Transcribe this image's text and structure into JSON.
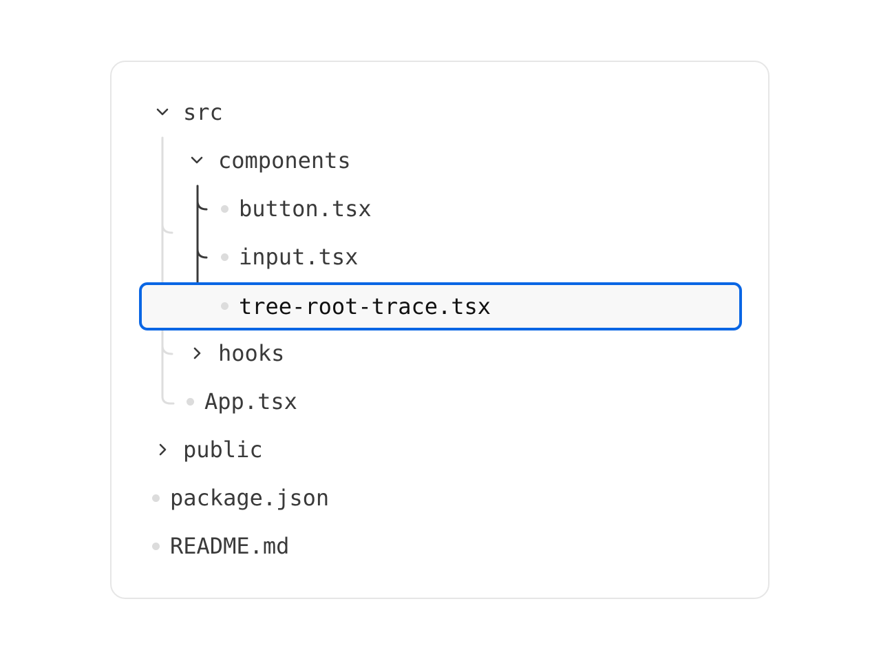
{
  "tree": {
    "src": {
      "label": "src",
      "state": "expanded"
    },
    "components": {
      "label": "components",
      "state": "expanded"
    },
    "button_tsx": {
      "label": "button.tsx"
    },
    "input_tsx": {
      "label": "input.tsx"
    },
    "tree_root_trace_tsx": {
      "label": "tree-root-trace.tsx",
      "selected": true
    },
    "hooks": {
      "label": "hooks",
      "state": "collapsed"
    },
    "app_tsx": {
      "label": "App.tsx"
    },
    "public": {
      "label": "public",
      "state": "collapsed"
    },
    "package_json": {
      "label": "package.json"
    },
    "readme_md": {
      "label": "README.md"
    }
  },
  "colors": {
    "selection_border": "#0a66e4",
    "selection_background": "#f8f8f8",
    "active_guide": "#3a3a3a",
    "inactive_guide": "#dedede",
    "file_dot": "#dcdcdc"
  },
  "icons": {
    "expanded": "chevron-down-icon",
    "collapsed": "chevron-right-icon",
    "file": "file-dot-icon"
  }
}
